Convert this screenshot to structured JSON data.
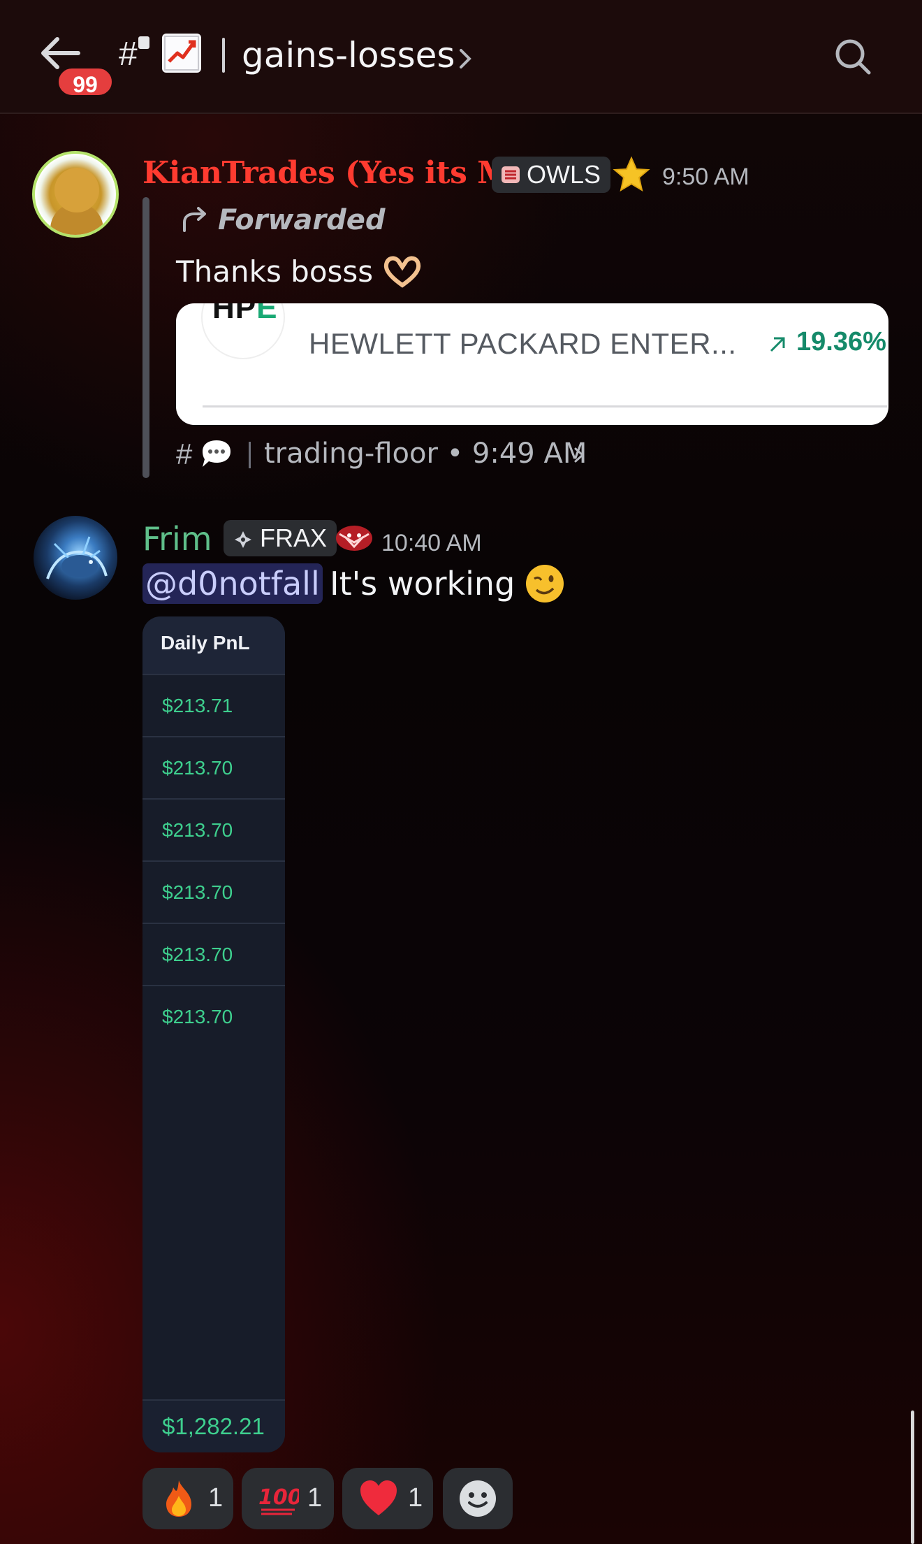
{
  "header": {
    "unread_count": "99",
    "hash": "#",
    "channel_name": "gains-losses"
  },
  "messages": [
    {
      "username": "KianTrades (Yes its Me)",
      "role_tag": "OWLS",
      "time": "9:50 AM",
      "forwarded_label": "Forwarded",
      "text": "Thanks bosss",
      "embed": {
        "logo_text_a": "HP",
        "logo_text_b": "E",
        "company": "HEWLETT PACKARD ENTER...",
        "change_pct": "19.36%"
      },
      "source": {
        "hash": "#",
        "channel": "trading-floor • 9:49 AM"
      }
    },
    {
      "username": "Frim",
      "role_tag": "FRAX",
      "time": "10:40 AM",
      "mention": "@d0notfall",
      "text": "It's working",
      "pnl_table": {
        "header": "Daily PnL",
        "rows": [
          "$213.71",
          "$213.70",
          "$213.70",
          "$213.70",
          "$213.70",
          "$213.70"
        ],
        "total": "$1,282.21"
      },
      "reactions": [
        {
          "emoji": "fire-icon",
          "count": "1"
        },
        {
          "emoji": "hundred-points-icon",
          "count": "1"
        },
        {
          "emoji": "heart-icon",
          "count": "1"
        },
        {
          "emoji": "add-reaction-icon",
          "count": ""
        }
      ]
    }
  ],
  "colors": {
    "kian_name": "#ff3b30",
    "frim_name": "#5fbf8a",
    "pnl_green": "#3ecf8e",
    "badge_red": "#e53e3e",
    "mention_bg": "#5865f2"
  }
}
